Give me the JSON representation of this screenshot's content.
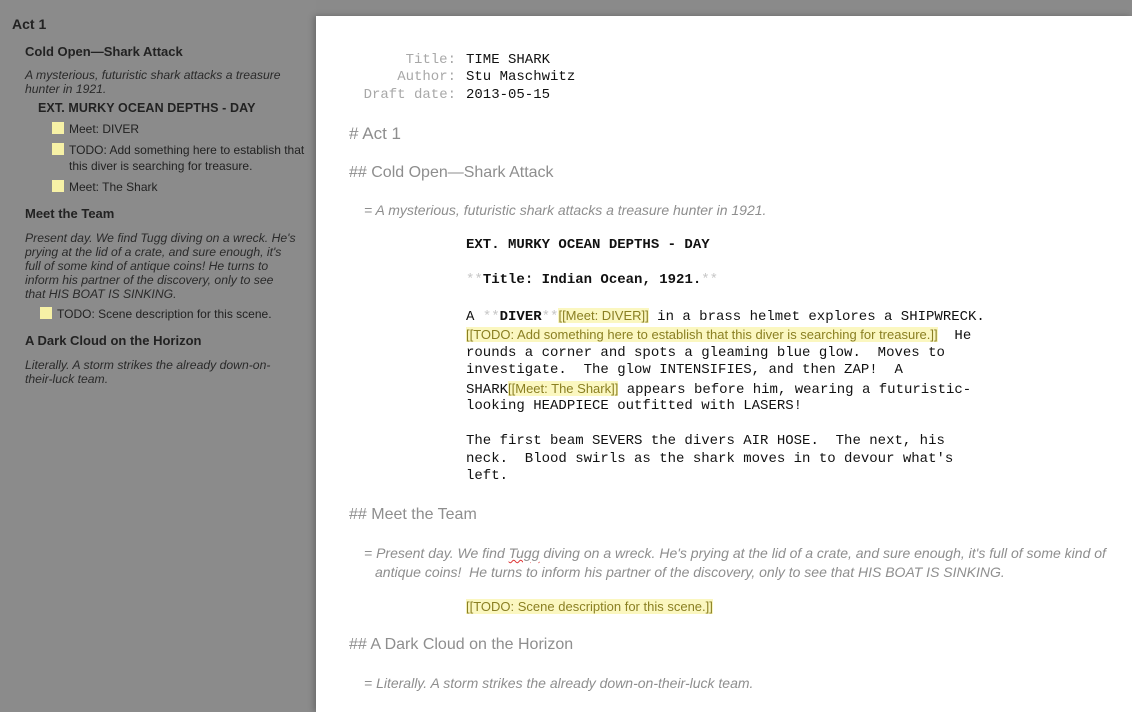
{
  "outline": {
    "act": "Act 1",
    "seq1": {
      "title": "Cold Open—Shark Attack",
      "synopsis": "A mysterious, futuristic shark attacks a treasure hunter in 1921.",
      "scene": "EXT. MURKY OCEAN DEPTHS - DAY",
      "notes": [
        "Meet: DIVER",
        "TODO: Add something here to establish that this diver is searching for treasure.",
        "Meet: The Shark"
      ]
    },
    "seq2": {
      "title": "Meet the Team",
      "synopsis": "Present day. We find Tugg diving on a wreck. He's prying at the lid of a crate, and sure enough, it's full of some kind of antique coins!  He turns to inform his partner of the discovery, only to see that HIS BOAT IS SINKING.",
      "note": "TODO: Scene description for this scene."
    },
    "seq3": {
      "title": "A Dark Cloud on the Horizon",
      "synopsis": "Literally. A storm strikes the already down-on-their-luck team."
    }
  },
  "editor": {
    "title_page": {
      "title_key": "Title:",
      "title_val": "TIME SHARK",
      "author_key": "Author:",
      "author_val": "Stu Maschwitz",
      "date_key": "Draft date:",
      "date_val": "2013-05-15"
    },
    "act_heading": "# Act 1",
    "seq1_heading": "## Cold Open—Shark Attack",
    "seq1_synopsis": "= A mysterious, futuristic shark attacks a treasure hunter in 1921.",
    "scene_heading": "EXT. MURKY OCEAN DEPTHS - DAY",
    "title_line": {
      "stars_open": "**",
      "text": "Title: Indian Ocean, 1921.",
      "stars_close": "**"
    },
    "action1": {
      "l1_a": "A ",
      "l1_stars1": "**",
      "l1_bold": "DIVER",
      "l1_stars2": "**",
      "l1_note": "[[Meet: DIVER]]",
      "l1_rest": " in a brass helmet explores a SHIPWRECK.",
      "l2_note": "[[TODO: Add something here to establish that this diver is searching for treasure.]]",
      "l2_rest": "  He",
      "l3": "rounds a corner and spots a gleaming blue glow.  Moves to",
      "l4": "investigate.  The glow INTENSIFIES, and then ZAP!  A",
      "l5_a": "SHARK",
      "l5_note": "[[Meet: The Shark]]",
      "l5_rest": " appears before him, wearing a futuristic-",
      "l6": "looking HEADPIECE outfitted with LASERS!"
    },
    "action2": {
      "l1": "The first beam SEVERS the divers AIR HOSE.  The next, his",
      "l2": "neck.  Blood swirls as the shark moves in to devour what's",
      "l3": "left."
    },
    "seq2_heading": "## Meet the Team",
    "seq2_syn_l1_a": "= Present day. We find ",
    "seq2_syn_l1_word": "Tugg",
    "seq2_syn_l1_b": " diving on a wreck. He's prying at the lid of a crate, and sure enough, it's full of some kind of",
    "seq2_syn_l2": "antique coins!  He turns to inform his partner of the discovery, only to see that HIS BOAT IS SINKING.",
    "seq2_note": "[[TODO: Scene description for this scene.]]",
    "seq3_heading": "## A Dark Cloud on the Horizon",
    "seq3_synopsis": "= Literally. A storm strikes the already down-on-their-luck team."
  }
}
